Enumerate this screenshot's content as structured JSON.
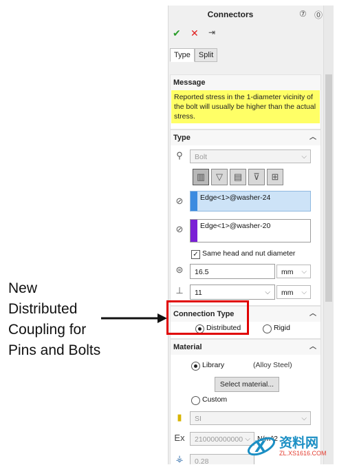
{
  "annotation": {
    "lines": [
      "New",
      "Distributed",
      "Coupling for",
      "Pins and Bolts"
    ]
  },
  "panel": {
    "title": "Connectors",
    "toolbar": {
      "ok": "✔",
      "cancel": "✕",
      "pin": "⇥"
    },
    "tabs": [
      "Type",
      "Split"
    ],
    "message": {
      "header": "Message",
      "text": "Reported stress in the 1-diameter vicinity of the bolt will usually be higher than the actual stress."
    },
    "type": {
      "header": "Type",
      "connector_type": "Bolt",
      "edge1": "Edge<1>@washer-24",
      "edge2": "Edge<1>@washer-20",
      "same_head_label": "Same head and nut diameter",
      "head_diameter": "16.5",
      "head_unit": "mm",
      "shank_diameter": "11",
      "shank_unit": "mm"
    },
    "connection_type": {
      "header": "Connection Type",
      "options": [
        "Distributed",
        "Rigid"
      ],
      "selected": "Distributed"
    },
    "material": {
      "header": "Material",
      "library_label": "Library",
      "library_value": "(Alloy Steel)",
      "select_button": "Select material...",
      "custom_label": "Custom",
      "units": "SI",
      "ex_label": "Ex",
      "ex_value": "210000000000",
      "ex_unit": "N/m^2",
      "nu_value": "0.28"
    }
  },
  "watermark": {
    "big": "资料网",
    "small": "ZL.XS1616.COM"
  },
  "colors": {
    "edge1": "#3b8be0",
    "edge2": "#7a1fd6",
    "highlight": "#e00000",
    "message_bg": "#ffff66"
  }
}
